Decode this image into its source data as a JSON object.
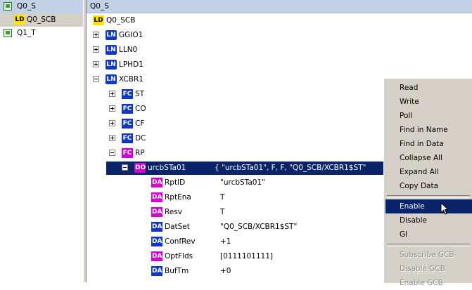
{
  "left_tree": {
    "items": [
      {
        "label": "Q0_S",
        "icon": "ied-icon",
        "selected": true
      },
      {
        "label": "Q0_SCB",
        "badge": "LD"
      },
      {
        "label": "Q1_T",
        "icon": "ied-icon"
      }
    ]
  },
  "right_tree": {
    "header": "Q0_S",
    "ld": {
      "badge": "LD",
      "label": "Q0_SCB"
    },
    "nodes": [
      {
        "badge": "LN",
        "label": "GGIO1"
      },
      {
        "badge": "LN",
        "label": "LLN0"
      },
      {
        "badge": "LN",
        "label": "LPHD1"
      },
      {
        "badge": "LN",
        "label": "XCBR1"
      }
    ],
    "fcs": [
      {
        "badge": "FC",
        "label": "ST"
      },
      {
        "badge": "FC",
        "label": "CO"
      },
      {
        "badge": "FC",
        "label": "CF"
      },
      {
        "badge": "FC",
        "label": "DC"
      },
      {
        "badge": "FC",
        "label": "RP"
      }
    ],
    "do": {
      "badge": "DO",
      "label": "urcbSTa01",
      "value": "{ \"urcbSTa01\", F, F, \"Q0_SCB/XCBR1$ST\""
    },
    "das": [
      {
        "badge": "DA",
        "label": "RptID",
        "value": "\"urcbSTa01\""
      },
      {
        "badge": "DA",
        "label": "RptEna",
        "value": "T"
      },
      {
        "badge": "DA",
        "label": "Resv",
        "value": "T"
      },
      {
        "badge": "DA",
        "label": "DatSet",
        "value": "\"Q0_SCB/XCBR1$ST\""
      },
      {
        "badge": "DA",
        "label": "ConfRev",
        "value": "+1"
      },
      {
        "badge": "DA",
        "label": "OptFlds",
        "value": "[0111101111]"
      },
      {
        "badge": "DA",
        "label": "BufTm",
        "value": "+0"
      }
    ]
  },
  "context_menu": {
    "items": [
      "Read",
      "Write",
      "Poll",
      "Find in Name",
      "Find in Data",
      "Collapse All",
      "Expand All",
      "Copy Data",
      "Enable",
      "Disable",
      "GI",
      "Subscribe GCB",
      "Disable GCB",
      "Enable GCB"
    ]
  },
  "colors": {
    "selection": "#0a246a",
    "header": "#c2d2e6",
    "badge_blue": "#1038c8",
    "badge_magenta": "#d400d4",
    "badge_ld": "#ffe000"
  }
}
